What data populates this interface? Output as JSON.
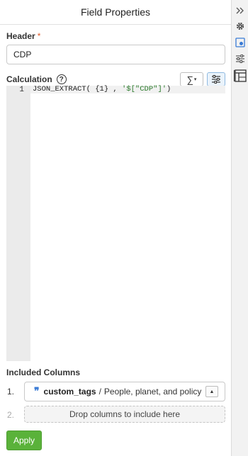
{
  "panel": {
    "title": "Field Properties"
  },
  "header": {
    "label": "Header",
    "required_marker": "*",
    "value": "CDP"
  },
  "calculation": {
    "label": "Calculation",
    "help_glyph": "?",
    "sigma_glyph": "∑",
    "caret_glyph": "▾",
    "editor_lines": [
      {
        "number": "1",
        "code_prefix": "JSON_EXTRACT( {1} , ",
        "code_string": "'$[\"CDP\"]'",
        "code_suffix": ")"
      }
    ]
  },
  "included_columns": {
    "label": "Included Columns",
    "rows": [
      {
        "number": "1.",
        "quote_glyph": "❞",
        "name": "custom_tags",
        "separator": "/",
        "path": "People, planet, and policy",
        "toggle_glyph": "▲"
      }
    ],
    "drop_row": {
      "number": "2.",
      "placeholder": "Drop columns to include here"
    }
  },
  "apply_button": {
    "label": "Apply"
  },
  "rail": {
    "icons": [
      "collapse-icon",
      "gear-icon",
      "field-settings-icon",
      "filter-sliders-icon",
      "table-columns-icon"
    ]
  },
  "colors": {
    "accent": "#3a7bd5",
    "apply_green": "#5ab23a",
    "required": "#e05a2a",
    "string": "#2a7a2a"
  }
}
